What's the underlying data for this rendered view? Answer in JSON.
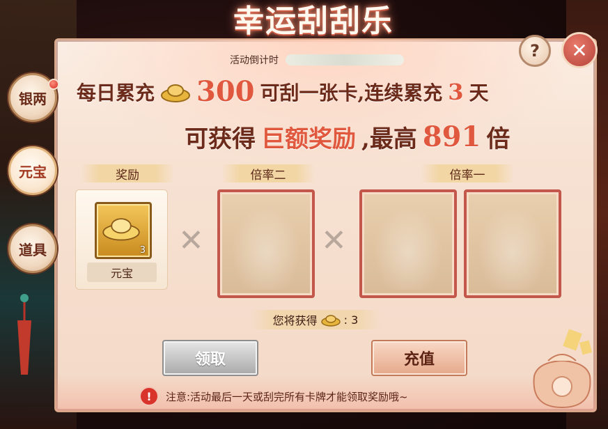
{
  "title": "幸运刮刮乐",
  "countdown": {
    "label": "活动倒计时"
  },
  "controls": {
    "help": "?",
    "close": "✕"
  },
  "side_tabs": [
    {
      "label": "银两",
      "active": false,
      "badge": true
    },
    {
      "label": "元宝",
      "active": true,
      "badge": false
    },
    {
      "label": "道具",
      "active": false,
      "badge": false
    }
  ],
  "headline": {
    "line1_prefix": "每日累充",
    "line1_amount": "300",
    "line1_mid": "可刮一张卡,连续累充",
    "line1_days": "3",
    "line1_suffix": "天",
    "line2_prefix": "可获得",
    "line2_highlight": "巨额奖励",
    "line2_mid": ",最高",
    "line2_multiplier": "891",
    "line2_suffix": "倍"
  },
  "sections": {
    "reward_label": "奖励",
    "rate2_label": "倍率二",
    "rate1_label": "倍率一"
  },
  "reward": {
    "name": "元宝",
    "count": "3",
    "icon": "gold-ingot-icon"
  },
  "times_symbol": "✕",
  "earn": {
    "prefix": "您将获得",
    "value": ": 3"
  },
  "buttons": {
    "claim": "领取",
    "recharge": "充值"
  },
  "notice": {
    "icon": "!",
    "text": "注意:活动最后一天或刮完所有卡牌才能领取奖励哦~"
  },
  "colors": {
    "accent_red": "#e0583e",
    "card_border": "#c4574b",
    "panel_bg": "#f7e2d3"
  }
}
